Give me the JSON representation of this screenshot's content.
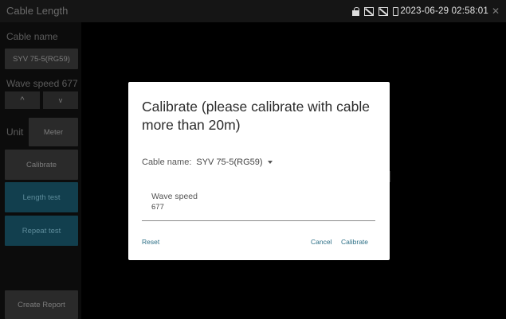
{
  "status_bar": {
    "app_title": "Cable Length",
    "datetime": "2023-06-29 02:58:01",
    "close_glyph": "✕",
    "icons": [
      "lock-icon",
      "network-off-icon",
      "network-off-icon",
      "battery-icon"
    ]
  },
  "sidebar": {
    "cable_name_label": "Cable name",
    "cable_name_value": "SYV 75-5(RG59)",
    "wave_speed_label": "Wave speed",
    "wave_speed_value": "677",
    "up_glyph": "^",
    "down_glyph": "v",
    "unit_label": "Unit",
    "unit_value": "Meter",
    "calibrate_label": "Calibrate",
    "length_test_label": "Length test",
    "repeat_test_label": "Repeat test",
    "create_report_label": "Create Report"
  },
  "dialog": {
    "title": "Calibrate (please calibrate with cable more than 20m)",
    "cable_name_label": "Cable name:",
    "cable_name_value": "SYV 75-5(RG59)",
    "wave_speed_label": "Wave speed",
    "wave_speed_value": "677",
    "reset_label": "Reset",
    "cancel_label": "Cancel",
    "calibrate_label": "Calibrate"
  },
  "colors": {
    "background": "#000000",
    "sidebar_button": "#2a2a2a",
    "teal_button": "#123f4e",
    "dialog_bg": "#ffffff",
    "link": "#2c6f86"
  }
}
